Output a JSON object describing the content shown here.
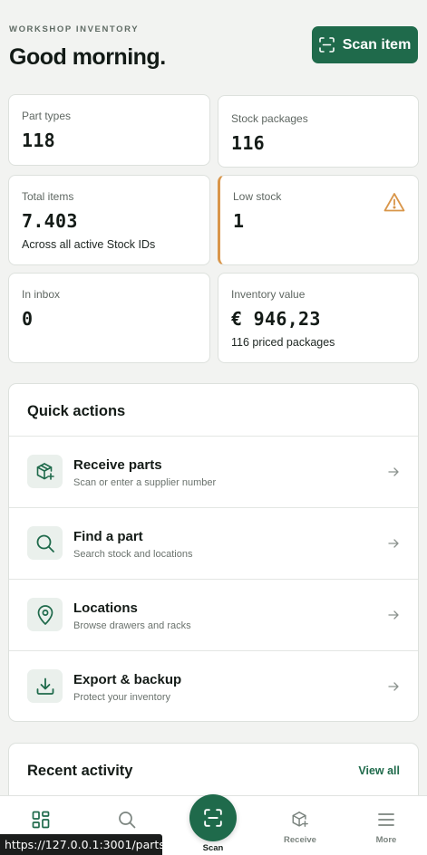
{
  "header": {
    "eyebrow": "WORKSHOP INVENTORY",
    "greeting": "Good morning.",
    "scan_button": "Scan item"
  },
  "stats": {
    "part_types": {
      "label": "Part types",
      "value": "118"
    },
    "stock_packages": {
      "label": "Stock packages",
      "value": "116"
    },
    "total_items": {
      "label": "Total items",
      "value": "7.403",
      "sub": "Across all active Stock IDs"
    },
    "low_stock": {
      "label": "Low stock",
      "value": "1",
      "icon": "warning-triangle-icon",
      "accent": "#d9964a"
    },
    "in_inbox": {
      "label": "In inbox",
      "value": "0"
    },
    "inventory_value": {
      "label": "Inventory value",
      "value": "€ 946,23",
      "sub": "116 priced packages"
    }
  },
  "quick_actions": {
    "title": "Quick actions",
    "items": [
      {
        "title": "Receive parts",
        "subtitle": "Scan or enter a supplier number",
        "icon": "package-add-icon"
      },
      {
        "title": "Find a part",
        "subtitle": "Search stock and locations",
        "icon": "search-icon"
      },
      {
        "title": "Locations",
        "subtitle": "Browse drawers and racks",
        "icon": "map-pin-icon"
      },
      {
        "title": "Export & backup",
        "subtitle": "Protect your inventory",
        "icon": "download-icon"
      }
    ]
  },
  "recent_activity": {
    "title": "Recent activity",
    "view_all": "View all"
  },
  "nav": {
    "scan": "Scan",
    "receive": "Receive",
    "more": "More"
  },
  "status_url": "https://127.0.0.1:3001/parts",
  "colors": {
    "brand": "#1f6a4b",
    "background": "#f2f3f1",
    "warning": "#d9964a"
  }
}
